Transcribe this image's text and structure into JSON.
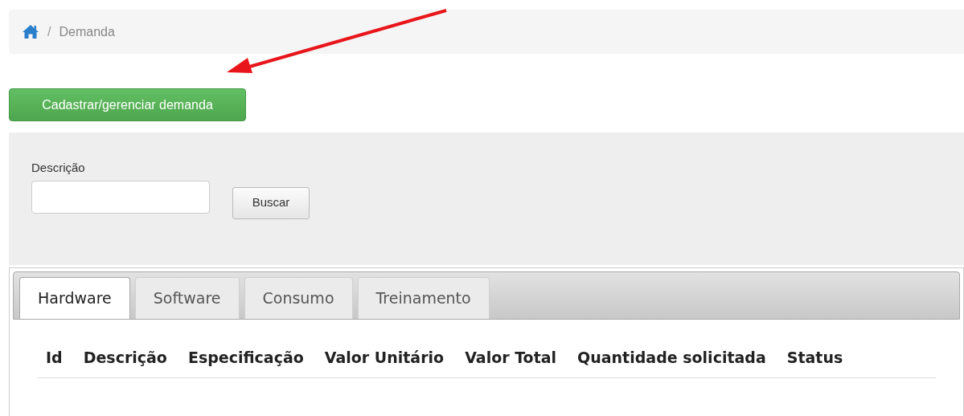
{
  "breadcrumb": {
    "separator": "/",
    "items": [
      "Demanda"
    ]
  },
  "actions": {
    "primary_button": "Cadastrar/gerenciar demanda"
  },
  "search_form": {
    "label": "Descrição",
    "button": "Buscar"
  },
  "tabs": [
    {
      "label": "Hardware",
      "selected": true
    },
    {
      "label": "Software",
      "selected": false
    },
    {
      "label": "Consumo",
      "selected": false
    },
    {
      "label": "Treinamento",
      "selected": false
    }
  ],
  "table": {
    "columns": [
      "Id",
      "Descrição",
      "Especificação",
      "Valor Unitário",
      "Valor Total",
      "Quantidade solicitada",
      "Status"
    ]
  },
  "annotation": {
    "kind": "arrow"
  }
}
